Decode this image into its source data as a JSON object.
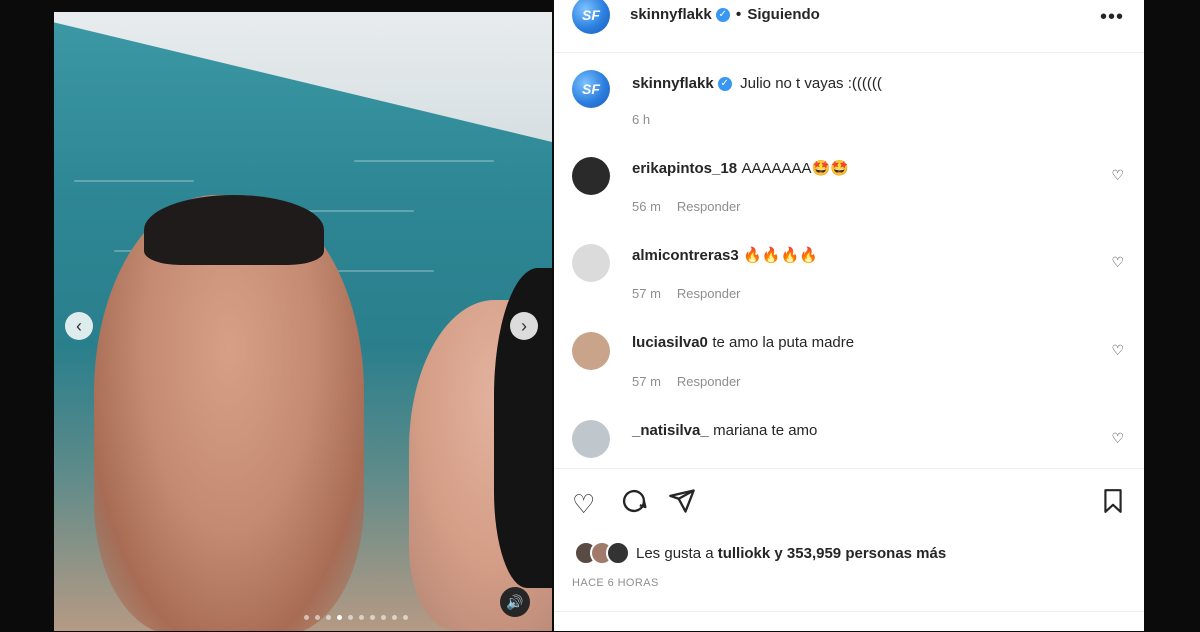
{
  "post": {
    "username": "skinnyflakk",
    "follow_status": "Siguiendo",
    "more_label": "•••",
    "avatar_text": "SF",
    "caption": "Julio no t vayas :((((((",
    "caption_time": "6 h"
  },
  "comments": [
    {
      "username": "erikapintos_18",
      "text": "AAAAAAA🤩🤩",
      "time": "56 m",
      "reply": "Responder",
      "avatar_color": "#2a2a2a"
    },
    {
      "username": "almicontreras3",
      "text": "🔥🔥🔥🔥",
      "time": "57 m",
      "reply": "Responder",
      "avatar_color": "#dbdbdb"
    },
    {
      "username": "luciasilva0",
      "text": "te amo la puta madre",
      "time": "57 m",
      "reply": "Responder",
      "avatar_color": "#c9a48a"
    },
    {
      "username": "_natisilva_",
      "text": "mariana te amo",
      "time": "",
      "reply": "",
      "avatar_color": "#bfc7cc"
    }
  ],
  "actions": {
    "like_icon": "heart-icon",
    "comment_icon": "comment-icon",
    "share_icon": "share-icon",
    "save_icon": "bookmark-icon",
    "likes_prefix": "Les gusta a",
    "likes_user": "tulliokk",
    "likes_suffix": "y 353,959 personas más",
    "posted": "HACE 6 HORAS"
  },
  "media": {
    "prev_icon": "chevron-left-icon",
    "next_icon": "chevron-right-icon",
    "audio_icon": "speaker-icon",
    "carousel_count": 10,
    "carousel_active": 4
  },
  "colors": {
    "verified": "#3897f0",
    "text": "#262626",
    "muted": "#8e8e8e"
  }
}
